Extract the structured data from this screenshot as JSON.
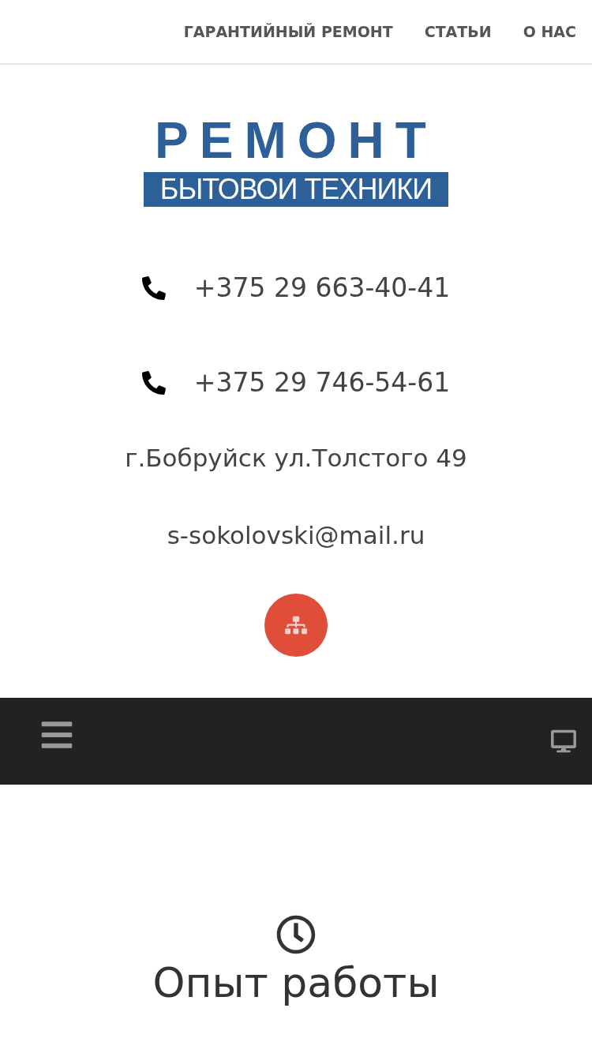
{
  "top_nav": {
    "items": [
      {
        "label": "ГАРАНТИЙНЫЙ РЕМОНТ"
      },
      {
        "label": "СТАТЬИ"
      },
      {
        "label": "О НАС"
      }
    ]
  },
  "logo": {
    "line_1": "РЕМОНТ",
    "line_2": "БЫТОВОИ ТЕХНИКИ"
  },
  "contacts": {
    "phones": [
      "+375 29 663-40-41",
      "+375 29 746-54-61"
    ],
    "address": "г.Бобруйск ул.Толстого 49",
    "email": "s-sokolovski@mail.ru"
  },
  "section": {
    "heading": "Опыт работы"
  }
}
